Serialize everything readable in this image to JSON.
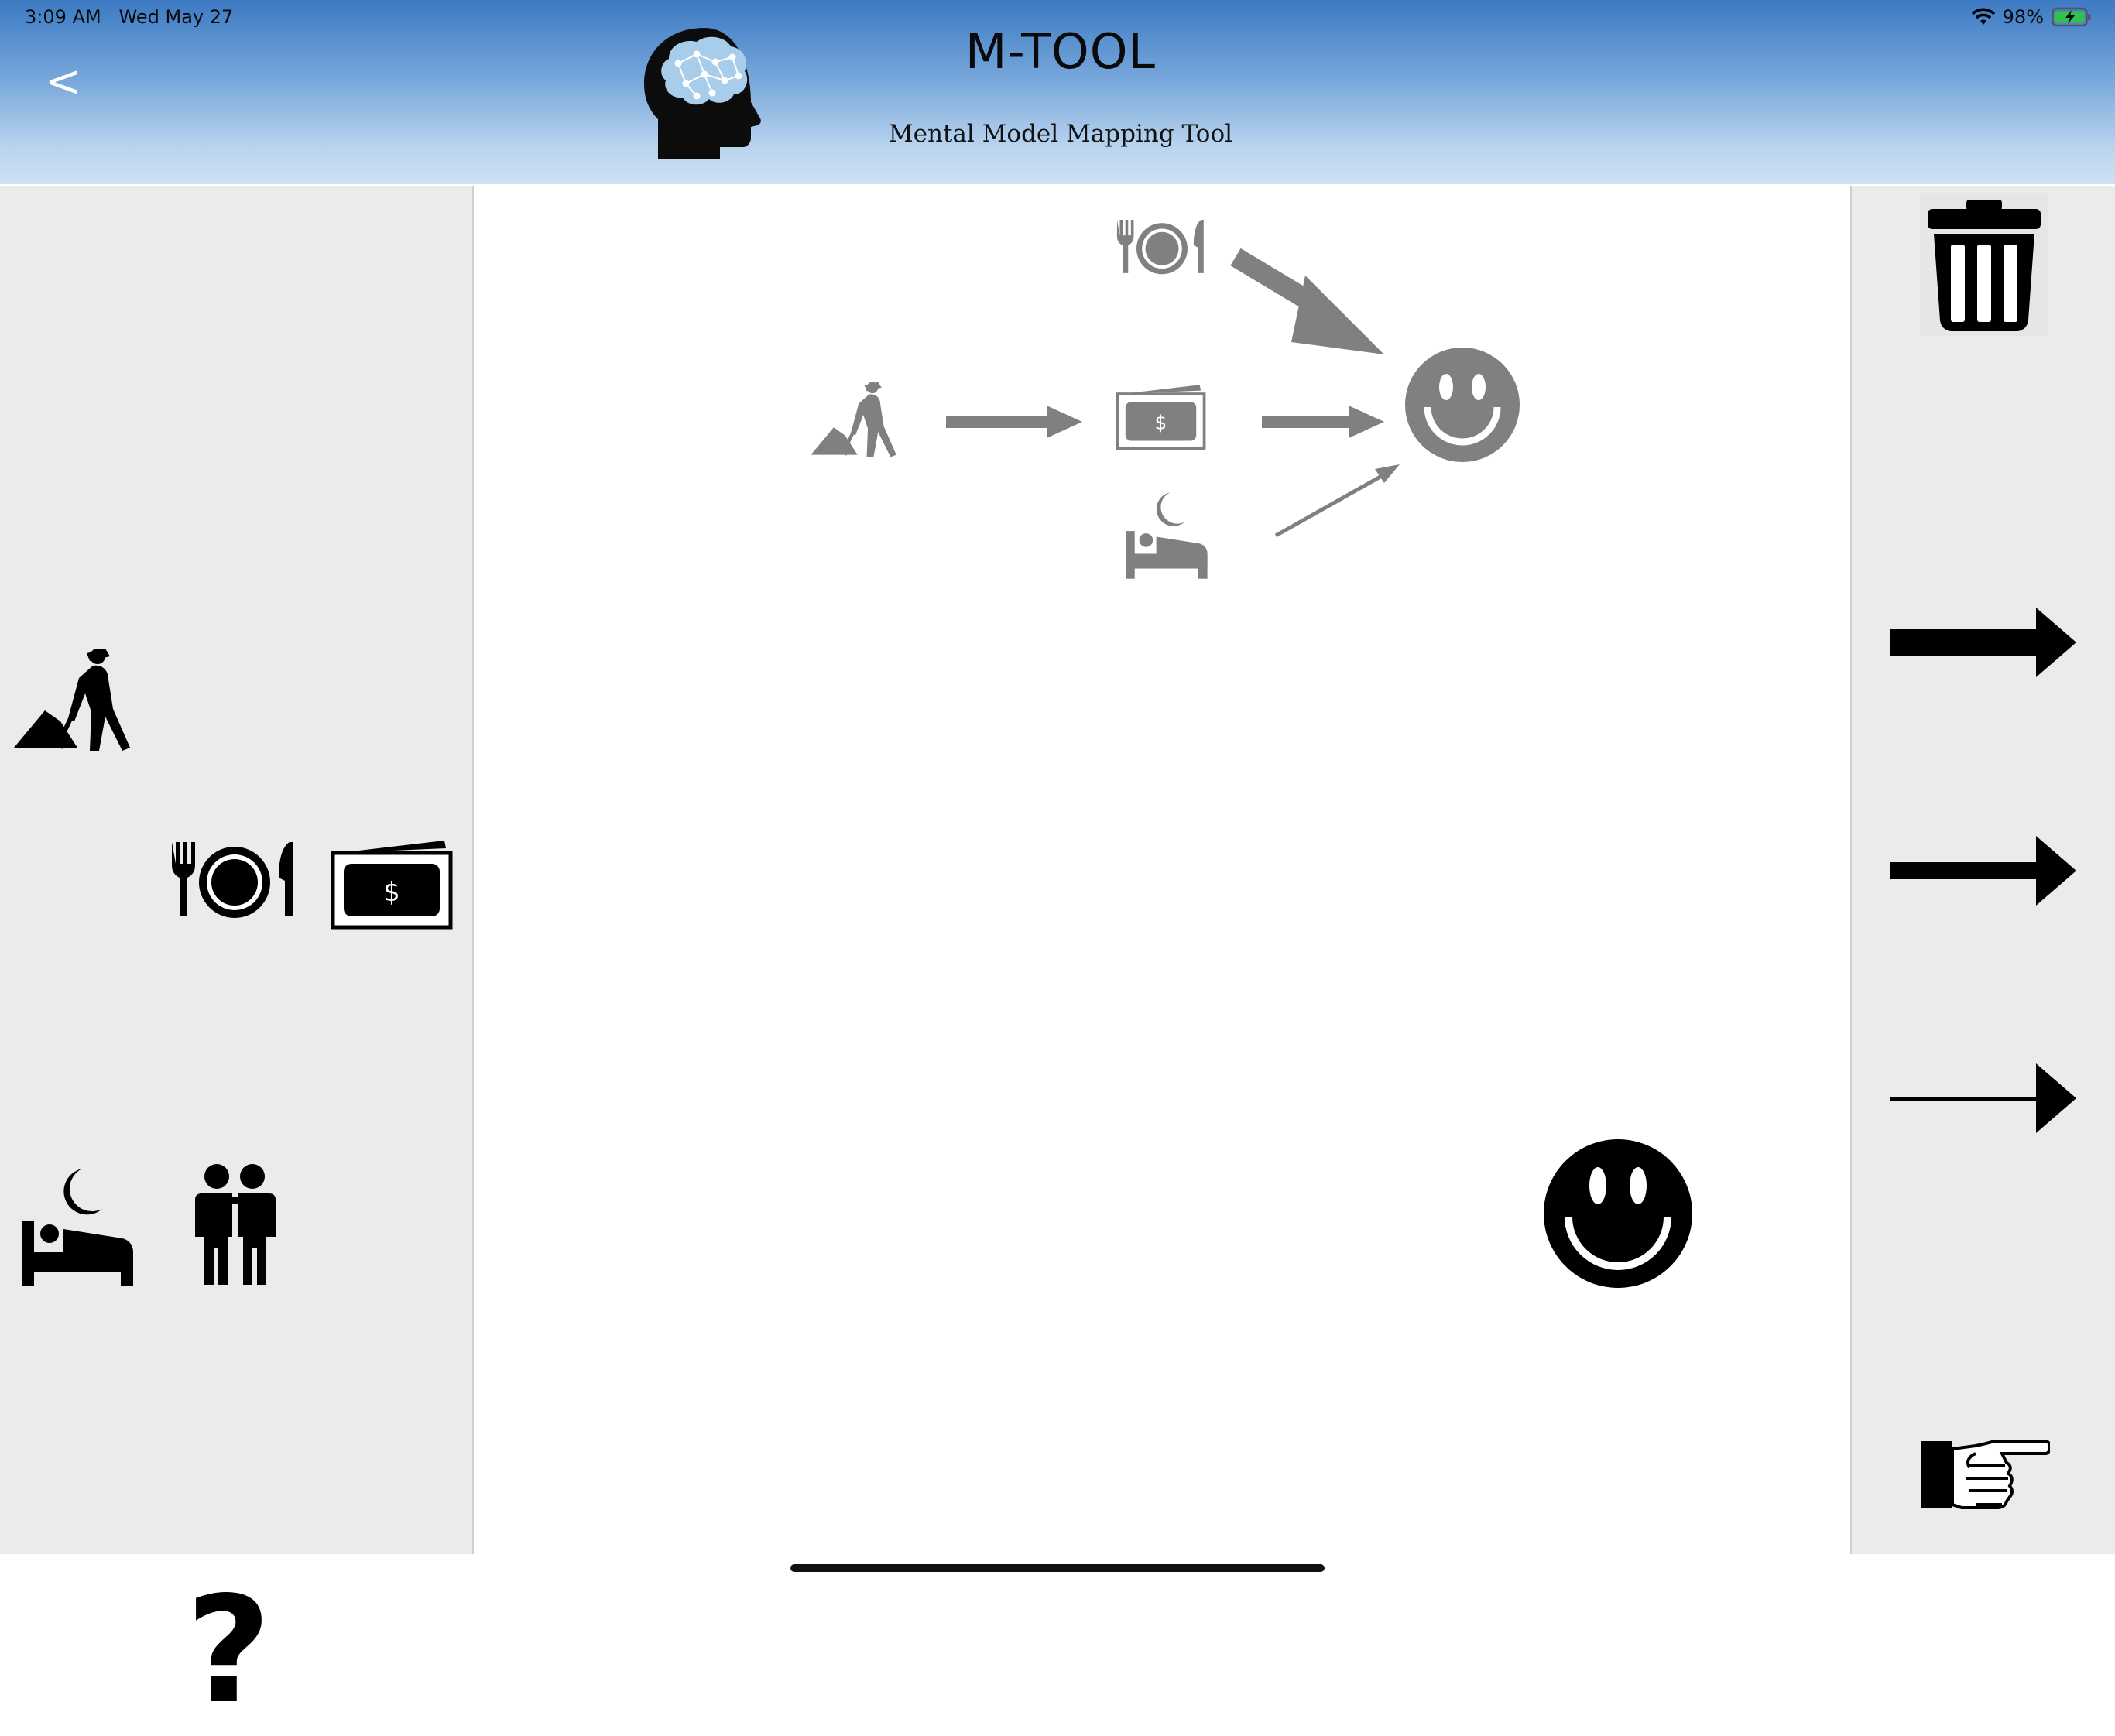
{
  "status_bar": {
    "time": "3:09 AM",
    "date": "Wed May 27",
    "battery": "98%"
  },
  "header": {
    "back_label": "<",
    "title": "M-TOOL",
    "subtitle": "Mental Model Mapping Tool"
  },
  "left_palette": {
    "items": [
      "worker-icon",
      "dinner-plate-icon",
      "money-icon",
      "sleep-bed-icon",
      "friends-icon",
      "question-mark-icon"
    ],
    "help_label": "?"
  },
  "right_toolbar": {
    "items": [
      "trash-icon",
      "thick-arrow-icon",
      "medium-arrow-icon",
      "thin-arrow-icon",
      "pointing-hand-icon"
    ]
  },
  "canvas": {
    "nodes": [
      "dinner-plate-node",
      "worker-node",
      "money-node",
      "sleep-bed-node",
      "smiley-node",
      "smiley-draggable"
    ],
    "edges": [
      {
        "from": "dinner-plate-node",
        "to": "smiley-node",
        "weight": "thick"
      },
      {
        "from": "worker-node",
        "to": "money-node",
        "weight": "medium"
      },
      {
        "from": "money-node",
        "to": "smiley-node",
        "weight": "medium"
      },
      {
        "from": "sleep-bed-node",
        "to": "smiley-node",
        "weight": "thin"
      }
    ]
  },
  "colors": {
    "header_top": "#3c7ac3",
    "header_bottom": "#cfe1f3",
    "panel": "#ebebeb",
    "icon_black": "#000000",
    "node_gray": "#808080"
  }
}
